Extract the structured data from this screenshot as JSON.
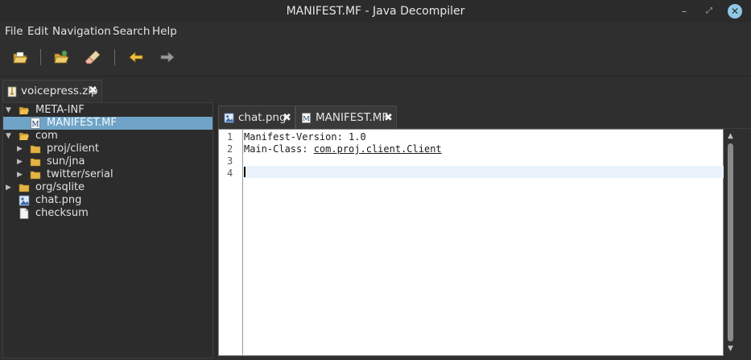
{
  "window": {
    "title": "MANIFEST.MF - Java Decompiler",
    "controls": {
      "minimize": "–",
      "maximize": "⤢",
      "close": "✕"
    }
  },
  "menu": [
    "File",
    "Edit",
    "Navigation",
    "Search",
    "Help"
  ],
  "toolbar": {
    "buttons": [
      "open-file-icon",
      "open-type-icon",
      "clear-icon",
      "back-icon",
      "forward-icon"
    ]
  },
  "file_tabs": [
    {
      "label": "voicepress.zip",
      "close": "✖"
    }
  ],
  "tree": {
    "rows": [
      {
        "label": "META-INF",
        "icon": "folder-open-icon",
        "arrow": "▼",
        "depth": 0
      },
      {
        "label": "MANIFEST.MF",
        "icon": "manifest-file-icon",
        "arrow": "",
        "depth": 1,
        "selected": true
      },
      {
        "label": "com",
        "icon": "folder-open-icon",
        "arrow": "▼",
        "depth": 0
      },
      {
        "label": "proj/client",
        "icon": "folder-icon",
        "arrow": "▶",
        "depth": 1
      },
      {
        "label": "sun/jna",
        "icon": "folder-icon",
        "arrow": "▶",
        "depth": 1
      },
      {
        "label": "twitter/serial",
        "icon": "folder-icon",
        "arrow": "▶",
        "depth": 1
      },
      {
        "label": "org/sqlite",
        "icon": "folder-icon",
        "arrow": "▶",
        "depth": 0
      },
      {
        "label": "chat.png",
        "icon": "image-file-icon",
        "arrow": "",
        "depth": 0
      },
      {
        "label": "checksum",
        "icon": "text-file-icon",
        "arrow": "",
        "depth": 0
      }
    ]
  },
  "editor_tabs": [
    {
      "label": "chat.png",
      "close": "✖"
    },
    {
      "label": "MANIFEST.MF",
      "close": "✖"
    }
  ],
  "editor": {
    "line_numbers": [
      "1",
      "2",
      "3",
      "4"
    ],
    "lines": {
      "l1": "Manifest-Version: 1.0",
      "l2_prefix": "Main-Class: ",
      "l2_link": "com.proj.client.Client"
    }
  },
  "scrollbar": {
    "up": "▲",
    "down": "▼"
  },
  "colors": {
    "selection": "#6fa4c8",
    "folder": "#e8b84a",
    "accent_close": "#8fc8e6"
  }
}
